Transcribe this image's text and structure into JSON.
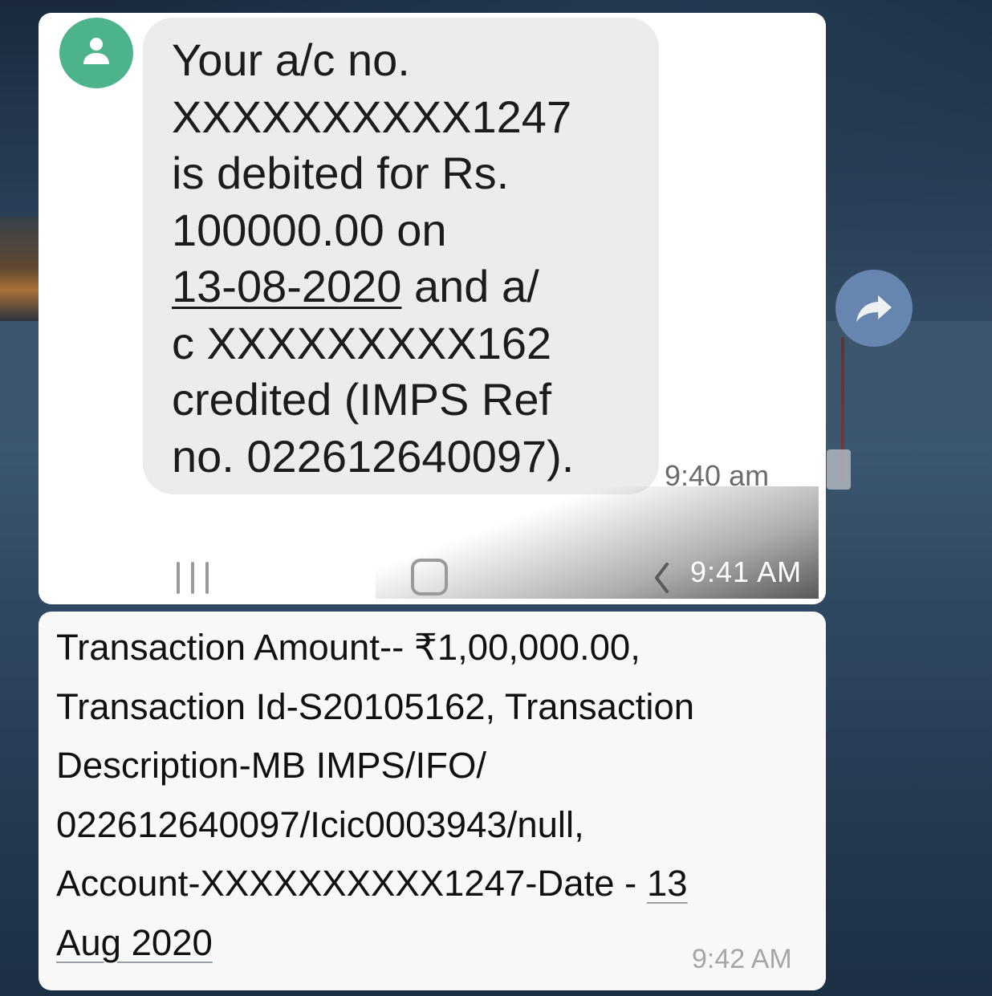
{
  "sms_card": {
    "message_lines": [
      "Your a/c no.",
      "XXXXXXXXXX1247",
      "is debited for Rs.",
      "100000.00 on",
      "13-08-2020",
      " and a/",
      "c XXXXXXXXX162",
      "credited (IMPS Ref",
      "no. 022612640097)."
    ],
    "message_time": "9:40 am",
    "status_time": "9:41 AM"
  },
  "forward_icon": "forward-share-icon",
  "text_card": {
    "lines": [
      "Transaction Amount-- ₹1,00,000.00,",
      "Transaction Id-S20105162, Transaction",
      "Description-MB IMPS/IFO/",
      "022612640097/Icic0003943/null,",
      "Account-XXXXXXXXXX1247-Date - ",
      "13",
      "Aug 2020"
    ],
    "time": "9:42 AM"
  },
  "colors": {
    "avatar": "#4cb38a",
    "bubble": "#ececed",
    "forward_button": "#6b8bb6"
  }
}
